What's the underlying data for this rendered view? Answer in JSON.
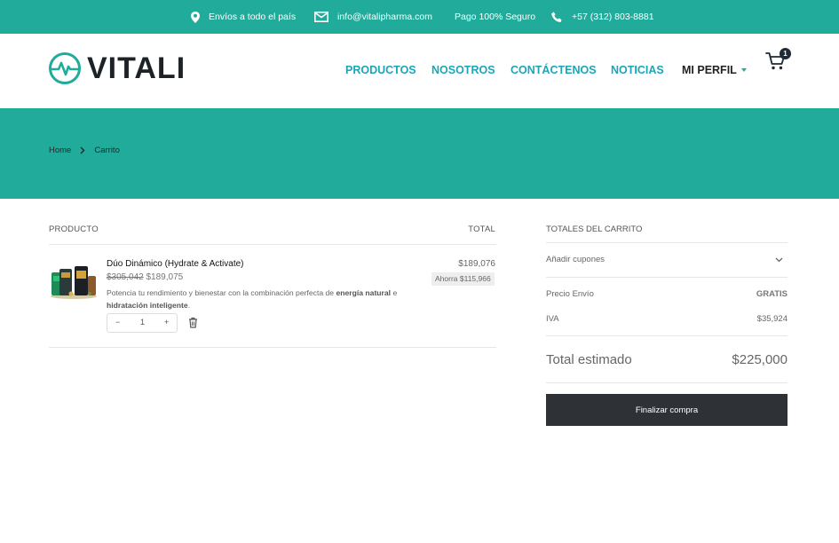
{
  "topbar": {
    "shipping": "Envíos a todo el país",
    "email": "info@vitalipharma.com",
    "secure": "Pago 100% Seguro",
    "phone": "+57 (312) 803-8881"
  },
  "header": {
    "logo_text": "VITALI",
    "nav": [
      "PRODUCTOS",
      "NOSOTROS",
      "CONTÁCTENOS",
      "NOTICIAS",
      "MI PERFIL"
    ],
    "cart_count": "1"
  },
  "breadcrumb": {
    "home": "Home",
    "current": "Carrito"
  },
  "cart_table": {
    "col_product": "PRODUCTO",
    "col_total": "TOTAL",
    "items": [
      {
        "name": "Dúo Dinámico (Hydrate & Activate)",
        "old_price": "$305,042",
        "price": "$189,075",
        "desc_start": "Potencia tu rendimiento y bienestar con la combinación perfecta de ",
        "desc_bold1": "energía natural",
        "desc_mid": " e ",
        "desc_bold2": "hidratación inteligente",
        "desc_end": ".",
        "quantity": "1",
        "minus": "−",
        "plus": "+",
        "line_total": "$189,076",
        "savings": "Ahorra $115,966"
      }
    ]
  },
  "totals": {
    "heading": "TOTALES DEL CARRITO",
    "coupons": "Añadir cupones",
    "shipping_label": "Precio Envío",
    "shipping_value": "GRATIS",
    "tax_label": "IVA",
    "tax_value": "$35,924",
    "estimated_label": "Total estimado",
    "estimated_value": "$225,000",
    "checkout_label": "Finalizar compra"
  },
  "colors": {
    "brand": "#21ab9a",
    "nav": "#1aa6b7",
    "button": "#2e3236"
  }
}
